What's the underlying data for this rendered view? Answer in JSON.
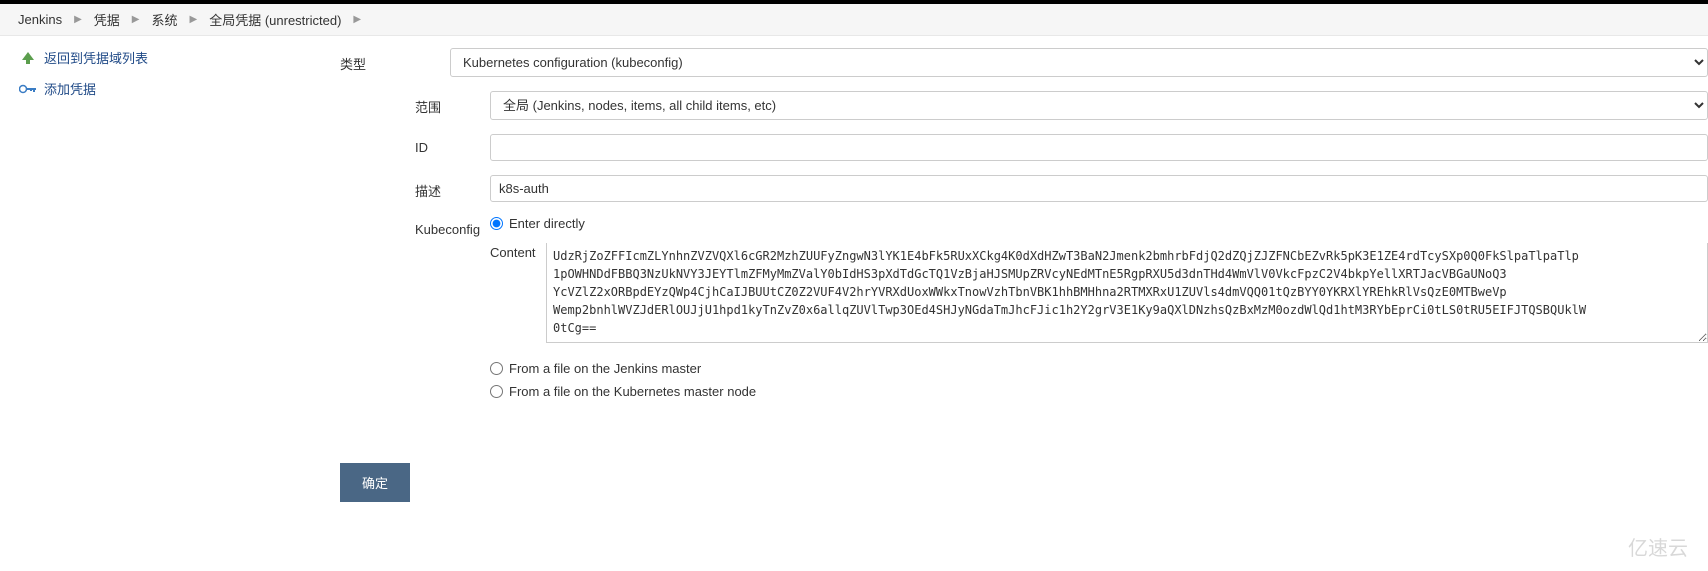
{
  "breadcrumb": {
    "items": [
      "Jenkins",
      "凭据",
      "系统",
      "全局凭据 (unrestricted)"
    ]
  },
  "sidebar": {
    "back_label": "返回到凭据域列表",
    "add_label": "添加凭据"
  },
  "form": {
    "kind_label": "类型",
    "kind_value": "Kubernetes configuration (kubeconfig)",
    "scope_label": "范围",
    "scope_value": "全局 (Jenkins, nodes, items, all child items, etc)",
    "id_label": "ID",
    "id_value": "",
    "desc_label": "描述",
    "desc_value": "k8s-auth",
    "kubeconfig_label": "Kubeconfig",
    "content_label": "Content",
    "radio_enter_directly": "Enter directly",
    "radio_file_master": "From a file on the Jenkins master",
    "radio_file_k8s": "From a file on the Kubernetes master node",
    "content_value": "UdzRjZoZFFIcmZLYnhnZVZVQXl6cGR2MzhZUUFyZngwN3lYK1E4bFk5RUxXCkg4K0dXdHZwT3BaN2Jmenk2bmhrbFdjQ2dZQjZJZFNCbEZvRk5pK3E1ZE4rdTcySXp0Q0FkSlpaTlpaTlp\n1pOWHNDdFBBQ3NzUkNVY3JEYTlmZFMyMmZValY0bIdHS3pXdTdGcTQ1VzBjaHJSMUpZRVcyNEdMTnE5RgpRXU5d3dnTHd4WmVlV0VkcFpzC2V4bkpYellXRTJacVBGaUNoQ3\nYcVZlZ2xORBpdEYzQWp4CjhCaIJBUUtCZ0Z2VUF4V2hrYVRXdUoxWWkxTnowVzhTbnVBK1hhBMHhna2RTMXRxU1ZUVls4dmVQQ01tQzBYY0YKRXlYREhkRlVsQzE0MTBweVp\nWemp2bnhlWVZJdERlOUJjU1hpd1kyTnZvZ0x6allqZUVlTwp3OEd4SHJyNGdaTmJhcFJic1h2Y2grV3E1Ky9aQXlDNzhsQzBxMzM0ozdWlQd1htM3RYbEprCi0tLS0tRU5EIFJTQSBQUklW\n0tCg==",
    "submit_label": "确定"
  },
  "watermark": "亿速云"
}
